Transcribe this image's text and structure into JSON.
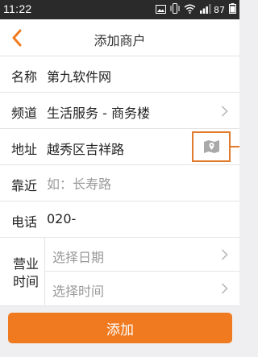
{
  "status_bar": {
    "time": "11:22",
    "battery_level": "87",
    "icons": [
      "image-icon",
      "vibrate-icon",
      "wifi-icon",
      "signal-icon",
      "battery-icon"
    ]
  },
  "header": {
    "title": "添加商户",
    "back_icon": "chevron-left-icon"
  },
  "form": {
    "name": {
      "label": "名称",
      "value": "第九软件网"
    },
    "channel": {
      "label": "频道",
      "value": "生活服务 - 商务楼"
    },
    "address": {
      "label": "地址",
      "value": "越秀区吉祥路",
      "map_icon": "map-pin-icon"
    },
    "nearby": {
      "label": "靠近",
      "placeholder": "如：长寿路"
    },
    "phone": {
      "label": "电话",
      "value": "020-"
    },
    "hours": {
      "label": "营业时间",
      "date_placeholder": "选择日期",
      "time_placeholder": "选择时间"
    }
  },
  "submit_label": "添加",
  "colors": {
    "accent": "#f07a1f",
    "highlight_border": "#e27a2b",
    "status_bar": "#2a2a2a"
  }
}
